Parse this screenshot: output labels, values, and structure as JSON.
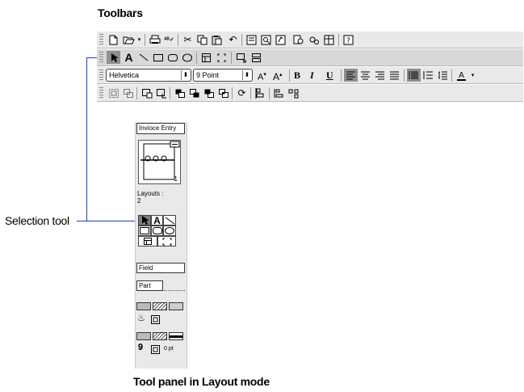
{
  "headings": {
    "toolbars": "Toolbars",
    "tool_panel": "Tool panel in Layout mode"
  },
  "callout": {
    "selection_tool": "Selection tool"
  },
  "toolbar_standard": {
    "icons": [
      "new-document-icon",
      "open-icon",
      "dropdown-arrow-icon",
      "print-icon",
      "spelling-icon",
      "cut-icon",
      "copy-icon",
      "paste-icon",
      "undo-icon",
      "browse-mode-icon",
      "find-mode-icon",
      "layout-mode-icon",
      "preview-icon",
      "scripts-icon",
      "define-fields-icon",
      "help-icon"
    ]
  },
  "toolbar_tools": {
    "text_tool": "A",
    "icons": [
      "pointer-icon",
      "text-icon",
      "line-icon",
      "rectangle-icon",
      "rounded-rectangle-icon",
      "oval-icon",
      "portal-icon",
      "button-icon",
      "field-tool-icon",
      "part-tool-icon"
    ]
  },
  "toolbar_text": {
    "font": "Helvetica",
    "size": "9 Point",
    "increase_label": "A",
    "decrease_label": "A",
    "bold": "B",
    "italic": "I",
    "underline": "U"
  },
  "toolbar_arrange": {
    "icons": [
      "group-icon",
      "ungroup-icon",
      "lock-icon",
      "unlock-icon",
      "bring-front-icon",
      "bring-forward-icon",
      "send-backward-icon",
      "send-back-icon",
      "rotate-icon",
      "align-icon",
      "set-alignment-icon",
      "distribute-icon"
    ]
  },
  "panel": {
    "layout_popup": "Invioce Entry",
    "page_number": "1",
    "layouts_label": "Layouts :",
    "layouts_count": "2",
    "text_tool": "A",
    "field_label": "Field",
    "part_label": "Part",
    "pen_width": "0 pt"
  }
}
